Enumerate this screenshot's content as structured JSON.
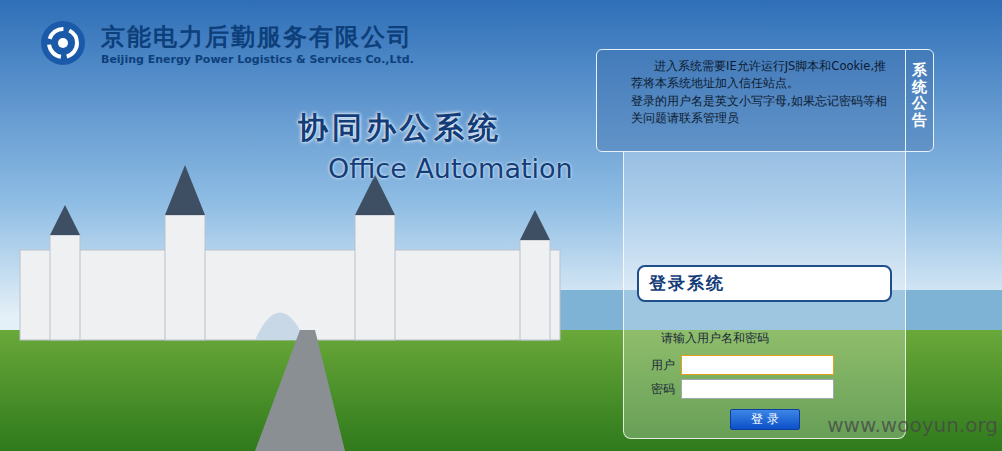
{
  "header": {
    "company": "京能电力后勤服务有限公司",
    "company_en": "Beijing Energy Power Logistics & Services Co.,Ltd."
  },
  "title": {
    "cn": "协同办公系统",
    "en": "Office Automation"
  },
  "notice": {
    "tab": "系统公告",
    "paragraphs": [
      "进入系统需要IE允许运行JS脚本和Cookie,推荐将本系统地址加入信任站点。",
      "登录的用户名是英文小写字母,如果忘记密码等相关问题请联系管理员"
    ]
  },
  "login": {
    "heading": "登录系统",
    "prompt": "请输入用户名和密码",
    "fields": [
      {
        "label": "用户",
        "value": "",
        "focused": true,
        "kind": "text"
      },
      {
        "label": "密码",
        "value": "",
        "focused": false,
        "kind": "password"
      }
    ],
    "button": "登 录"
  },
  "watermark": "www.wooyun.org"
}
